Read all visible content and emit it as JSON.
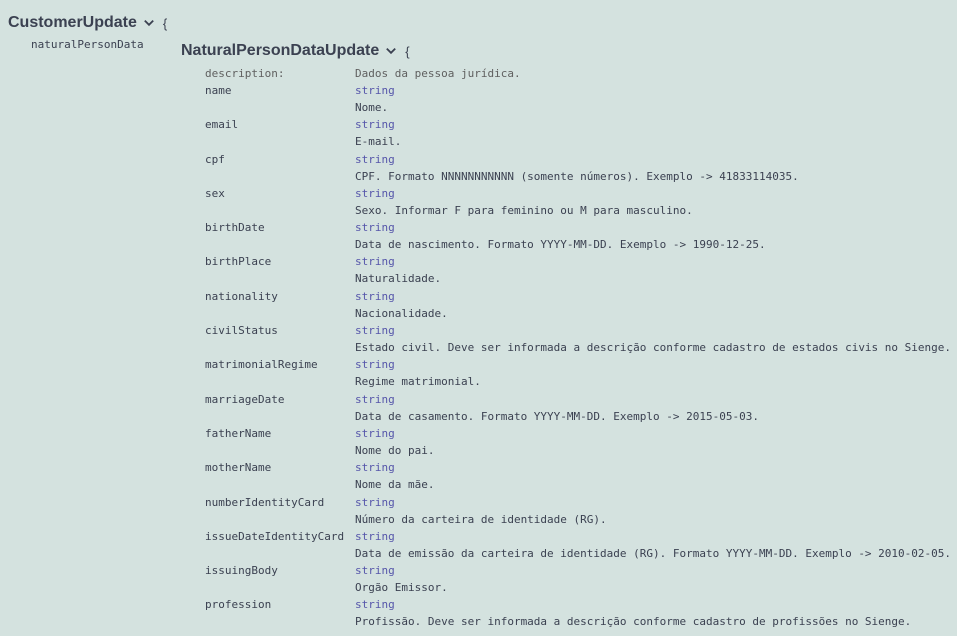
{
  "customer": {
    "title": "CustomerUpdate",
    "brace": "{",
    "property": "naturalPersonData"
  },
  "natural": {
    "title": "NaturalPersonDataUpdate",
    "brace": "{",
    "description_key": "description:",
    "description_value": "Dados da pessoa jurídica.",
    "properties": [
      {
        "name": "name",
        "type": "string",
        "description": "Nome."
      },
      {
        "name": "email",
        "type": "string",
        "description": "E-mail."
      },
      {
        "name": "cpf",
        "type": "string",
        "description": "CPF. Formato NNNNNNNNNNN (somente números). Exemplo -> 41833114035."
      },
      {
        "name": "sex",
        "type": "string",
        "description": "Sexo. Informar F para feminino ou M para masculino."
      },
      {
        "name": "birthDate",
        "type": "string",
        "description": "Data de nascimento. Formato YYYY-MM-DD. Exemplo -> 1990-12-25."
      },
      {
        "name": "birthPlace",
        "type": "string",
        "description": "Naturalidade."
      },
      {
        "name": "nationality",
        "type": "string",
        "description": "Nacionalidade."
      },
      {
        "name": "civilStatus",
        "type": "string",
        "description": "Estado civil. Deve ser informada a descrição conforme cadastro de estados civis no Sienge."
      },
      {
        "name": "matrimonialRegime",
        "type": "string",
        "description": "Regime matrimonial."
      },
      {
        "name": "marriageDate",
        "type": "string",
        "description": "Data de casamento. Formato YYYY-MM-DD. Exemplo -> 2015-05-03."
      },
      {
        "name": "fatherName",
        "type": "string",
        "description": "Nome do pai."
      },
      {
        "name": "motherName",
        "type": "string",
        "description": "Nome da mãe."
      },
      {
        "name": "numberIdentityCard",
        "type": "string",
        "description": "Número da carteira de identidade (RG)."
      },
      {
        "name": "issueDateIdentityCard",
        "type": "string",
        "description": "Data de emissão da carteira de identidade (RG). Formato YYYY-MM-DD. Exemplo -> 2010-02-05."
      },
      {
        "name": "issuingBody",
        "type": "string",
        "description": "Orgão Emissor."
      },
      {
        "name": "profession",
        "type": "string",
        "description": "Profissão. Deve ser informada a descrição conforme cadastro de profissões no Sienge."
      }
    ]
  }
}
